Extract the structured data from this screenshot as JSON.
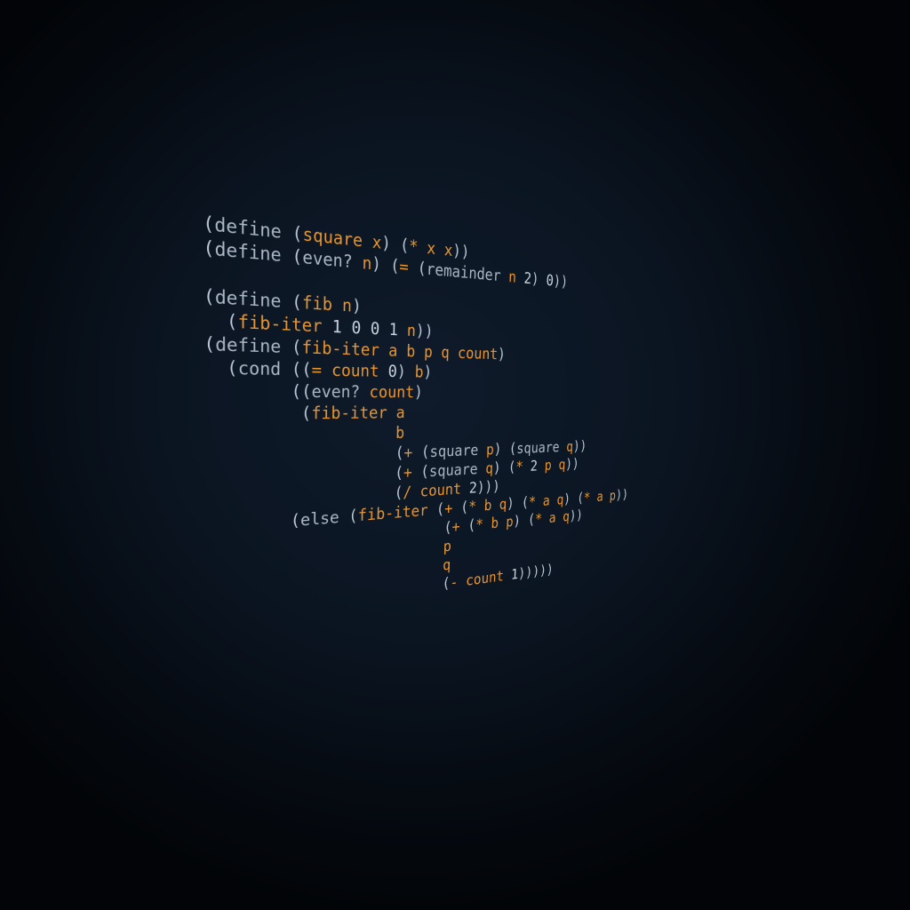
{
  "colors": {
    "background": "#0b1522",
    "keyword": "#aab6c3",
    "identifier": "#e8952e",
    "punctuation": "#b9c7d6"
  },
  "code": {
    "language": "scheme",
    "lines": [
      [
        [
          "p",
          "("
        ],
        [
          "k",
          "define "
        ],
        [
          "p",
          "("
        ],
        [
          "f",
          "square "
        ],
        [
          "v",
          "x"
        ],
        [
          "p",
          ") ("
        ],
        [
          "f",
          "* "
        ],
        [
          "v",
          "x x"
        ],
        [
          "p",
          "))"
        ]
      ],
      [
        [
          "p",
          "("
        ],
        [
          "k",
          "define "
        ],
        [
          "p",
          "("
        ],
        [
          "k",
          "even? "
        ],
        [
          "v",
          "n"
        ],
        [
          "p",
          ") ("
        ],
        [
          "f",
          "= "
        ],
        [
          "p",
          "("
        ],
        [
          "k",
          "remainder "
        ],
        [
          "v",
          "n "
        ],
        [
          "n",
          "2"
        ],
        [
          "p",
          ") "
        ],
        [
          "n",
          "0"
        ],
        [
          "p",
          "))"
        ]
      ],
      [],
      [
        [
          "p",
          "("
        ],
        [
          "k",
          "define "
        ],
        [
          "p",
          "("
        ],
        [
          "f",
          "fib "
        ],
        [
          "v",
          "n"
        ],
        [
          "p",
          ")"
        ]
      ],
      [
        [
          "p",
          "  ("
        ],
        [
          "f",
          "fib-iter "
        ],
        [
          "n",
          "1 0 0 1 "
        ],
        [
          "v",
          "n"
        ],
        [
          "p",
          "))"
        ]
      ],
      [
        [
          "p",
          "("
        ],
        [
          "k",
          "define "
        ],
        [
          "p",
          "("
        ],
        [
          "f",
          "fib-iter "
        ],
        [
          "v",
          "a b p q count"
        ],
        [
          "p",
          ")"
        ]
      ],
      [
        [
          "p",
          "  ("
        ],
        [
          "k",
          "cond "
        ],
        [
          "p",
          "(("
        ],
        [
          "f",
          "= "
        ],
        [
          "v",
          "count "
        ],
        [
          "n",
          "0"
        ],
        [
          "p",
          ") "
        ],
        [
          "v",
          "b"
        ],
        [
          "p",
          ")"
        ]
      ],
      [
        [
          "p",
          "        (("
        ],
        [
          "k",
          "even? "
        ],
        [
          "v",
          "count"
        ],
        [
          "p",
          ")"
        ]
      ],
      [
        [
          "p",
          "         ("
        ],
        [
          "f",
          "fib-iter "
        ],
        [
          "v",
          "a"
        ]
      ],
      [
        [
          "p",
          "                   "
        ],
        [
          "v",
          "b"
        ]
      ],
      [
        [
          "p",
          "                   ("
        ],
        [
          "f",
          "+ "
        ],
        [
          "p",
          "("
        ],
        [
          "k",
          "square "
        ],
        [
          "v",
          "p"
        ],
        [
          "p",
          ") ("
        ],
        [
          "k",
          "square "
        ],
        [
          "v",
          "q"
        ],
        [
          "p",
          "))"
        ]
      ],
      [
        [
          "p",
          "                   ("
        ],
        [
          "f",
          "+ "
        ],
        [
          "p",
          "("
        ],
        [
          "k",
          "square "
        ],
        [
          "v",
          "q"
        ],
        [
          "p",
          ") ("
        ],
        [
          "f",
          "* "
        ],
        [
          "n",
          "2 "
        ],
        [
          "v",
          "p q"
        ],
        [
          "p",
          "))"
        ]
      ],
      [
        [
          "p",
          "                   ("
        ],
        [
          "f",
          "/ "
        ],
        [
          "v",
          "count "
        ],
        [
          "n",
          "2"
        ],
        [
          "p",
          ")))"
        ]
      ],
      [
        [
          "p",
          "        ("
        ],
        [
          "k",
          "else "
        ],
        [
          "p",
          "("
        ],
        [
          "f",
          "fib-iter "
        ],
        [
          "p",
          "("
        ],
        [
          "f",
          "+ "
        ],
        [
          "p",
          "("
        ],
        [
          "f",
          "* "
        ],
        [
          "v",
          "b q"
        ],
        [
          "p",
          ") ("
        ],
        [
          "f",
          "* "
        ],
        [
          "v",
          "a q"
        ],
        [
          "p",
          ") ("
        ],
        [
          "f",
          "* "
        ],
        [
          "v",
          "a p"
        ],
        [
          "p",
          "))"
        ]
      ],
      [
        [
          "p",
          "                         ("
        ],
        [
          "f",
          "+ "
        ],
        [
          "p",
          "("
        ],
        [
          "f",
          "* "
        ],
        [
          "v",
          "b p"
        ],
        [
          "p",
          ") ("
        ],
        [
          "f",
          "* "
        ],
        [
          "v",
          "a q"
        ],
        [
          "p",
          "))"
        ]
      ],
      [
        [
          "p",
          "                         "
        ],
        [
          "v",
          "p"
        ]
      ],
      [
        [
          "p",
          "                         "
        ],
        [
          "v",
          "q"
        ]
      ],
      [
        [
          "p",
          "                         ("
        ],
        [
          "f",
          "- "
        ],
        [
          "v",
          "count "
        ],
        [
          "n",
          "1"
        ],
        [
          "p",
          ")))))"
        ]
      ]
    ]
  }
}
